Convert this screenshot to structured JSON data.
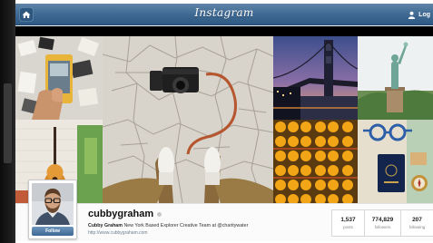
{
  "app": {
    "title": "Instagram"
  },
  "header": {
    "home_icon": "home-icon",
    "user_icon": "user-icon",
    "login_label": "Log"
  },
  "profile": {
    "username": "cubbygraham",
    "bio_name": "Cubby Graham",
    "bio_text": "New York Based Explorer Creative Team at @charitywater",
    "url": "http://www.cubbygraham.com",
    "follow_label": "Follow",
    "stats": [
      {
        "value": "1,537",
        "label": "posts"
      },
      {
        "value": "774,829",
        "label": "followers"
      },
      {
        "value": "207",
        "label": "following"
      }
    ]
  }
}
